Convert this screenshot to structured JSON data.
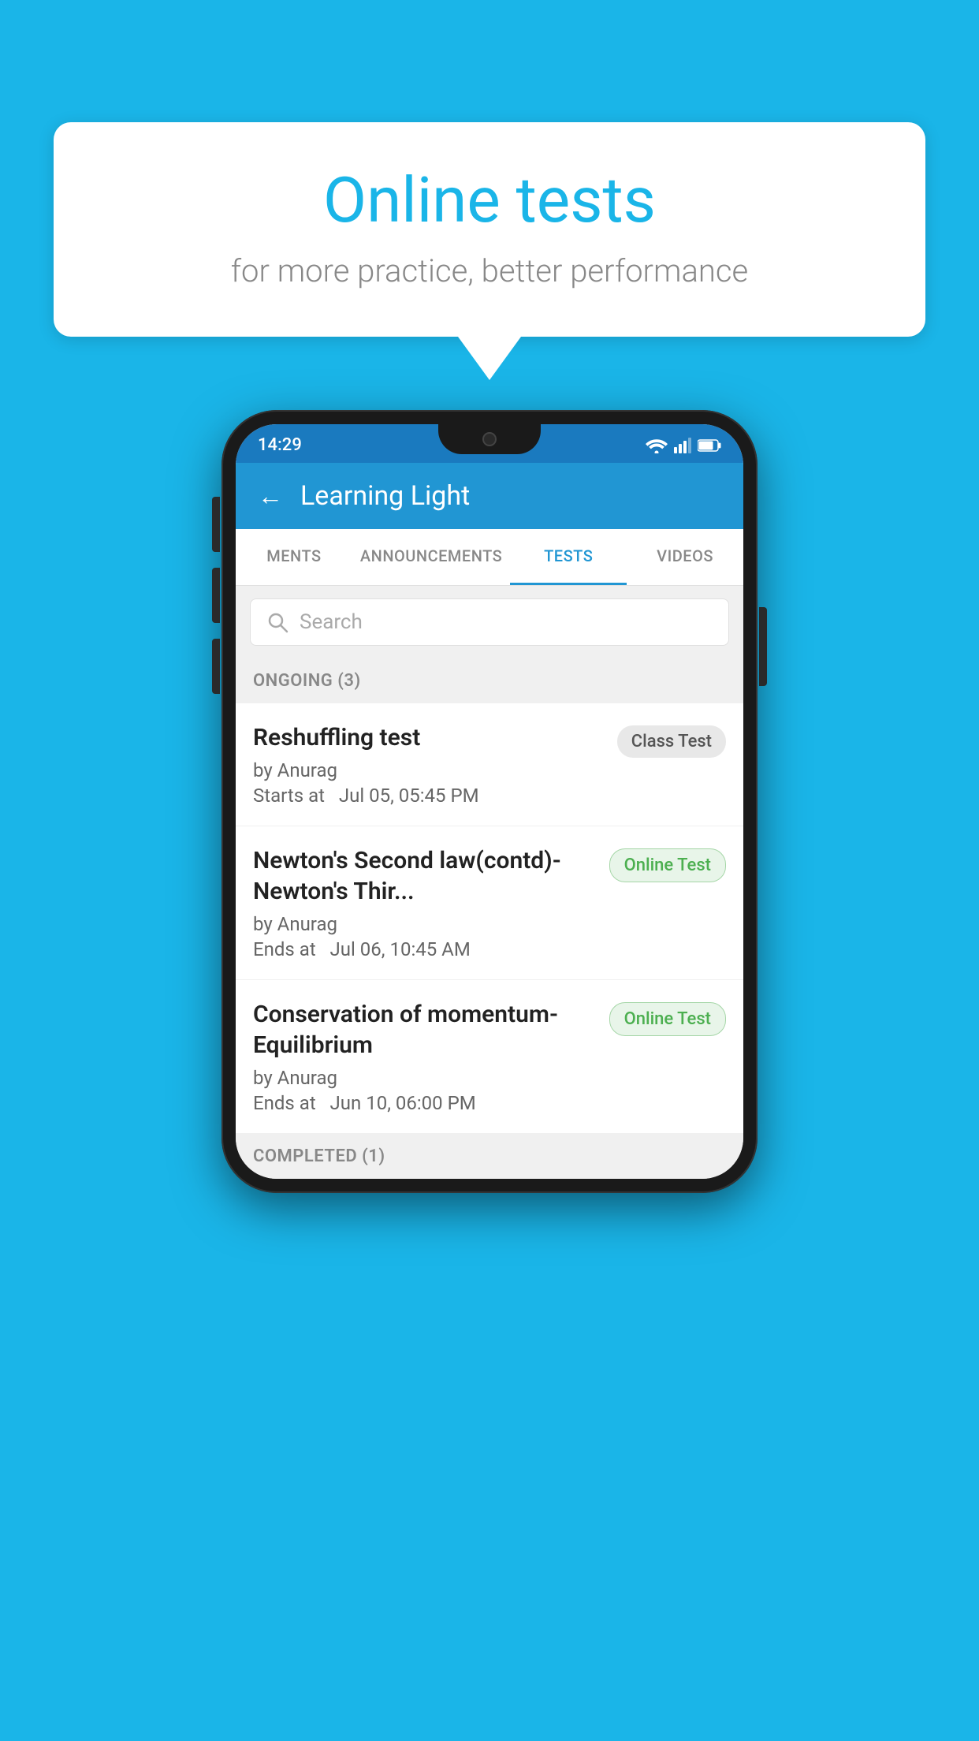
{
  "background": {
    "color": "#1ab5e8"
  },
  "speech_bubble": {
    "title": "Online tests",
    "subtitle": "for more practice, better performance"
  },
  "phone": {
    "status_bar": {
      "time": "14:29",
      "icons": [
        "wifi",
        "signal",
        "battery"
      ]
    },
    "header": {
      "back_label": "←",
      "title": "Learning Light"
    },
    "tabs": [
      {
        "label": "MENTS",
        "active": false
      },
      {
        "label": "ANNOUNCEMENTS",
        "active": false
      },
      {
        "label": "TESTS",
        "active": true
      },
      {
        "label": "VIDEOS",
        "active": false
      }
    ],
    "search": {
      "placeholder": "Search"
    },
    "ongoing_section": {
      "label": "ONGOING (3)"
    },
    "test_items": [
      {
        "name": "Reshuffling test",
        "author": "by Anurag",
        "date_label": "Starts at",
        "date": "Jul 05, 05:45 PM",
        "badge": "Class Test",
        "badge_type": "class"
      },
      {
        "name": "Newton's Second law(contd)-Newton's Thir...",
        "author": "by Anurag",
        "date_label": "Ends at",
        "date": "Jul 06, 10:45 AM",
        "badge": "Online Test",
        "badge_type": "online"
      },
      {
        "name": "Conservation of momentum-Equilibrium",
        "author": "by Anurag",
        "date_label": "Ends at",
        "date": "Jun 10, 06:00 PM",
        "badge": "Online Test",
        "badge_type": "online"
      }
    ],
    "completed_section": {
      "label": "COMPLETED (1)"
    }
  }
}
